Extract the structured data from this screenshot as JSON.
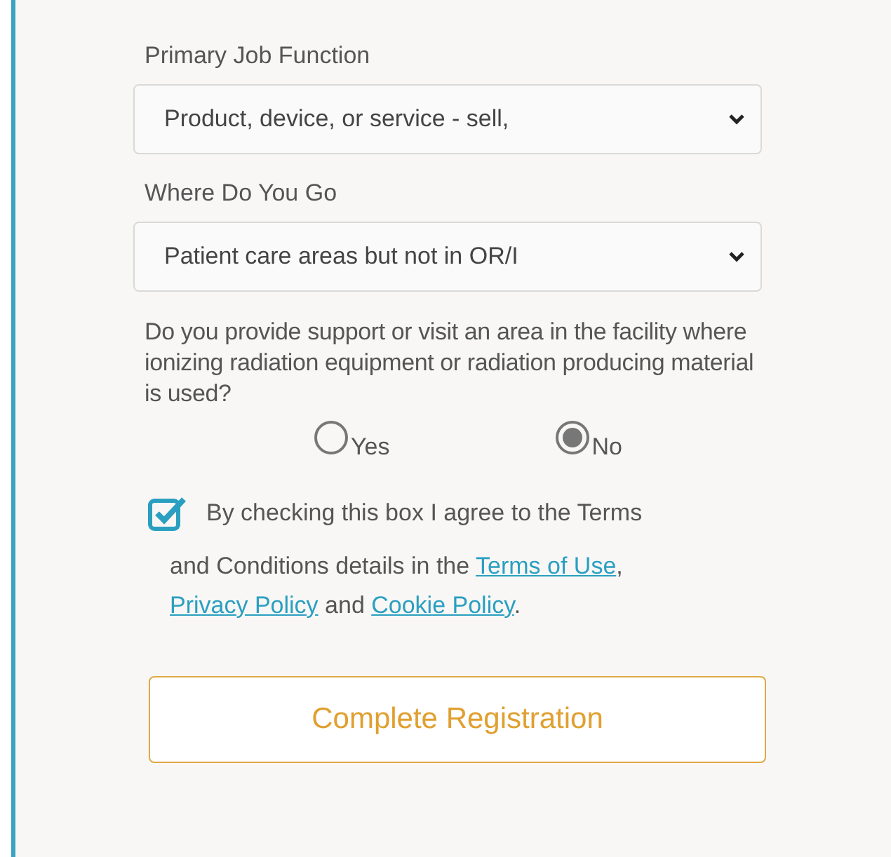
{
  "fields": [
    {
      "label": "Primary Job Function",
      "value": "Product, device, or service - sell,"
    },
    {
      "label": "Where Do You Go",
      "value": "Patient care areas but not in OR/I"
    }
  ],
  "question": {
    "text": "Do you provide support or visit an area in the facility where ionizing radiation equipment or radiation producing material is used?",
    "options": [
      {
        "label": "Yes",
        "selected": false
      },
      {
        "label": "No",
        "selected": true
      }
    ]
  },
  "agreement": {
    "checked": true,
    "lead": "By checking this box I agree to the Terms",
    "parts": [
      {
        "kind": "text",
        "text": "and Conditions details in the "
      },
      {
        "kind": "link",
        "text": "Terms of Use"
      },
      {
        "kind": "text",
        "text": ", "
      },
      {
        "kind": "link",
        "text": "Privacy Policy"
      },
      {
        "kind": "text",
        "text": " and "
      },
      {
        "kind": "link",
        "text": "Cookie Policy"
      },
      {
        "kind": "text",
        "text": "."
      }
    ]
  },
  "button": "Complete Registration"
}
